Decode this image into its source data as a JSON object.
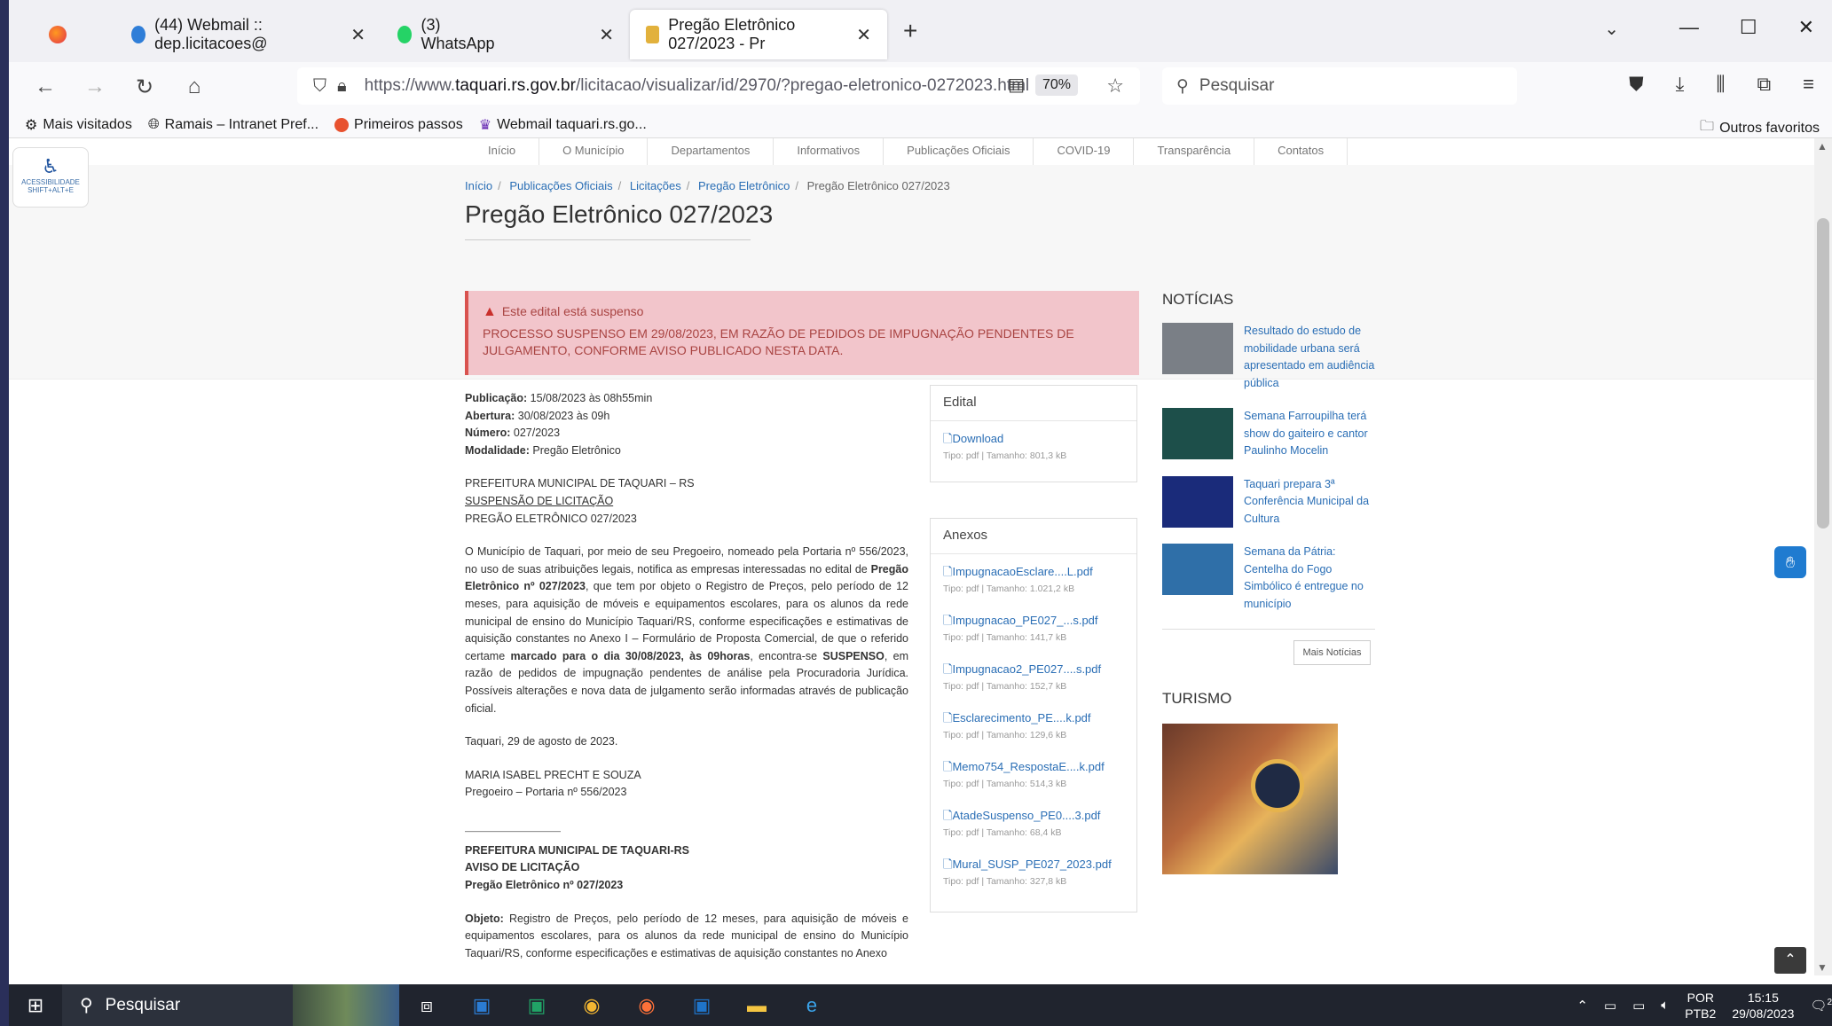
{
  "browser": {
    "tabs": [
      {
        "label": "(44) Webmail :: dep.licitacoes@",
        "active": false
      },
      {
        "label": "(3) WhatsApp",
        "active": false
      },
      {
        "label": "Pregão Eletrônico 027/2023 - Pr",
        "active": true
      }
    ],
    "url_prefix": "https://www.",
    "url_domain": "taquari.rs.gov.br",
    "url_path": "/licitacao/visualizar/id/2970/?pregao-eletronico-0272023.html",
    "zoom": "70%",
    "search_placeholder": "Pesquisar",
    "bookmarks": [
      "Mais visitados",
      "Ramais – Intranet Pref...",
      "Primeiros passos",
      "Webmail taquari.rs.go..."
    ],
    "other_bookmarks": "Outros favoritos"
  },
  "site": {
    "menu": [
      "Início",
      "O Município",
      "Departamentos",
      "Informativos",
      "Publicações Oficiais",
      "COVID-19",
      "Transparência",
      "Contatos"
    ],
    "accessibility": "ACESSIBILIDADE SHIFT+ALT+E",
    "breadcrumb": [
      "Início",
      "Publicações Oficiais",
      "Licitações",
      "Pregão Eletrônico",
      "Pregão Eletrônico 027/2023"
    ],
    "title": "Pregão Eletrônico 027/2023",
    "alert": {
      "heading": "Este edital está suspenso",
      "body": "PROCESSO SUSPENSO EM 29/08/2023, EM RAZÃO DE PEDIDOS DE IMPUGNAÇÃO PENDENTES DE JULGAMENTO, CONFORME AVISO PUBLICADO NESTA DATA."
    },
    "meta": {
      "publicacao_label": "Publicação:",
      "publicacao": "15/08/2023 às 08h55min",
      "abertura_label": "Abertura:",
      "abertura": "30/08/2023 às 09h",
      "numero_label": "Número:",
      "numero": "027/2023",
      "modalidade_label": "Modalidade:",
      "modalidade": "Pregão Eletrônico"
    },
    "body": {
      "org": "PREFEITURA MUNICIPAL DE TAQUARI – RS",
      "susp": "SUSPENSÃO DE LICITAÇÃO",
      "pe": "PREGÃO ELETRÔNICO 027/2023",
      "p1a": "O Município de Taquari, por meio de seu Pregoeiro, nomeado pela Portaria nº 556/2023, no uso de suas atribuições legais, notifica as empresas interessadas no edital de ",
      "p1b": "Pregão Eletrônico nº 027/2023",
      "p1c": ", que tem por objeto o Registro de Preços, pelo período de 12 meses, para aquisição de móveis e equipamentos escolares, para os alunos da rede municipal de ensino do Município Taquari/RS, conforme especificações e estimativas de aquisição constantes no Anexo I – Formulário de Proposta Comercial, de que o referido certame ",
      "p1d": "marcado para o dia 30/08/2023, às 09horas",
      "p1e": ", encontra-se ",
      "p1f": "SUSPENSO",
      "p1g": ", em razão de pedidos de impugnação pendentes de análise pela Procuradoria Jurídica. Possíveis alterações e nova data de julgamento serão informadas através de publicação oficial.",
      "date": "Taquari, 29 de agosto de 2023.",
      "sign1": "MARIA ISABEL PRECHT E SOUZA",
      "sign2": "Pregoeiro – Portaria nº 556/2023",
      "dashes": "————————————",
      "org2": "PREFEITURA MUNICIPAL DE TAQUARI-RS",
      "aviso": "AVISO DE LICITAÇÃO",
      "pe2": "Pregão Eletrônico nº 027/2023",
      "obj_label": "Objeto:",
      "obj": " Registro de Preços, pelo período de 12 meses, para aquisição de móveis e equipamentos escolares, para os alunos da rede municipal de ensino do Município Taquari/RS, conforme especificações e estimativas de aquisição constantes no Anexo"
    },
    "edital": {
      "title": "Edital",
      "file": {
        "name": "Download",
        "meta": "Tipo: pdf | Tamanho: 801,3 kB"
      }
    },
    "anexos": {
      "title": "Anexos",
      "files": [
        {
          "name": "ImpugnacaoEsclare....L.pdf",
          "meta": "Tipo: pdf | Tamanho: 1.021,2 kB"
        },
        {
          "name": "Impugnacao_PE027_...s.pdf",
          "meta": "Tipo: pdf | Tamanho: 141,7 kB"
        },
        {
          "name": "Impugnacao2_PE027....s.pdf",
          "meta": "Tipo: pdf | Tamanho: 152,7 kB"
        },
        {
          "name": "Esclarecimento_PE....k.pdf",
          "meta": "Tipo: pdf | Tamanho: 129,6 kB"
        },
        {
          "name": "Memo754_RespostaE....k.pdf",
          "meta": "Tipo: pdf | Tamanho: 514,3 kB"
        },
        {
          "name": "AtadeSuspenso_PE0....3.pdf",
          "meta": "Tipo: pdf | Tamanho: 68,4 kB"
        },
        {
          "name": "Mural_SUSP_PE027_2023.pdf",
          "meta": "Tipo: pdf | Tamanho: 327,8 kB"
        }
      ]
    },
    "news": {
      "title": "NOTÍCIAS",
      "items": [
        {
          "text": "Resultado do estudo de mobilidade urbana será apresentado em audiência pública",
          "color": "#7a7f86"
        },
        {
          "text": "Semana Farroupilha terá show do gaiteiro e cantor Paulinho Mocelin",
          "color": "#1d4f4a"
        },
        {
          "text": "Taquari prepara 3ª Conferência Municipal da Cultura",
          "color": "#1a2b7a"
        },
        {
          "text": "Semana da Pátria: Centelha do Fogo Simbólico é entregue no município",
          "color": "#2f6fa8"
        }
      ],
      "more": "Mais Notícias",
      "turismo": "TURISMO"
    }
  },
  "taskbar": {
    "search": "Pesquisar",
    "lang1": "POR",
    "lang2": "PTB2",
    "time": "15:15",
    "date": "29/08/2023",
    "notif": "2"
  }
}
